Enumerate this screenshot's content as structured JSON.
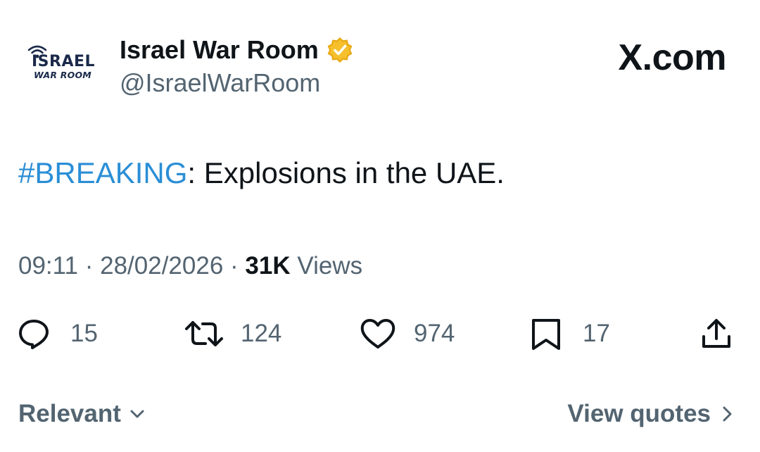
{
  "account": {
    "logo_line1": "ISRAEL",
    "logo_line2": "WAR ROOM",
    "display_name": "Israel War Room",
    "handle": "@IsraelWarRoom",
    "verified_badge_color": "#f4b400"
  },
  "site": {
    "brand": "X.com"
  },
  "tweet": {
    "hashtag": "#BREAKING",
    "text": ": Explosions in the UAE.",
    "hashtag_color": "#2a8ed6"
  },
  "meta": {
    "time": "09:11",
    "separator": "·",
    "date": "28/02/2026",
    "views_count": "31K",
    "views_label": "Views"
  },
  "actions": {
    "replies": "15",
    "reposts": "124",
    "likes": "974",
    "bookmarks": "17",
    "icons": [
      "reply-icon",
      "repost-icon",
      "like-icon",
      "bookmark-icon",
      "share-icon"
    ]
  },
  "footer": {
    "sort_label": "Relevant",
    "quotes_label": "View quotes"
  },
  "colors": {
    "text_primary": "#0f1419",
    "text_secondary": "#536471"
  }
}
